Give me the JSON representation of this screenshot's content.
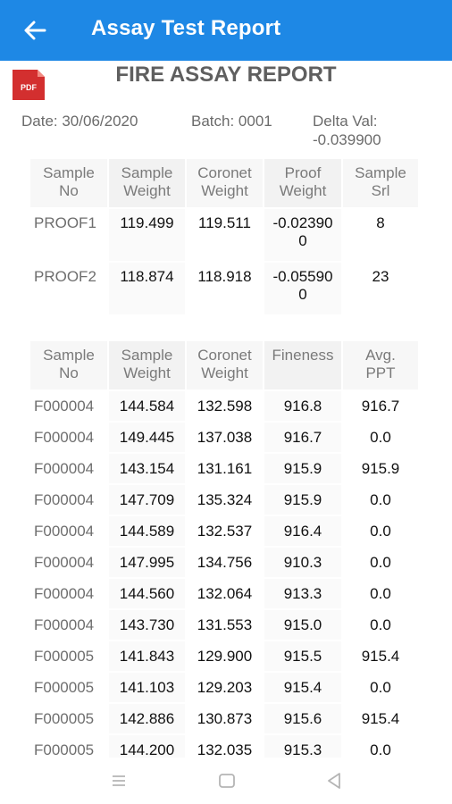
{
  "appbar": {
    "title": "Assay Test Report",
    "back_icon": "arrow-left-icon"
  },
  "report": {
    "pdf_label": "PDF",
    "title": "FIRE ASSAY REPORT",
    "date": "Date: 30/06/2020",
    "batch": "Batch: 0001",
    "delta_label": "Delta Val:",
    "delta_value": "-0.039900"
  },
  "proof_table": {
    "headers": [
      [
        "Sample",
        "No"
      ],
      [
        "Sample",
        "Weight"
      ],
      [
        "Coronet",
        "Weight"
      ],
      [
        "Proof",
        "Weight"
      ],
      [
        "Sample",
        "Srl"
      ]
    ],
    "rows": [
      [
        "PROOF1",
        "119.499",
        "119.511",
        "-0.02390",
        "0",
        "8"
      ],
      [
        "PROOF2",
        "118.874",
        "118.918",
        "-0.05590",
        "0",
        "23"
      ]
    ]
  },
  "sample_table": {
    "headers": [
      [
        "Sample",
        "No"
      ],
      [
        "Sample",
        "Weight"
      ],
      [
        "Coronet",
        "Weight"
      ],
      [
        "Fineness",
        ""
      ],
      [
        "Avg.",
        "PPT"
      ]
    ],
    "rows": [
      [
        "F000004",
        "144.584",
        "132.598",
        "916.8",
        "916.7"
      ],
      [
        "F000004",
        "149.445",
        "137.038",
        "916.7",
        "0.0"
      ],
      [
        "F000004",
        "143.154",
        "131.161",
        "915.9",
        "915.9"
      ],
      [
        "F000004",
        "147.709",
        "135.324",
        "915.9",
        "0.0"
      ],
      [
        "F000004",
        "144.589",
        "132.537",
        "916.4",
        "0.0"
      ],
      [
        "F000004",
        "147.995",
        "134.756",
        "910.3",
        "0.0"
      ],
      [
        "F000004",
        "144.560",
        "132.064",
        "913.3",
        "0.0"
      ],
      [
        "F000004",
        "143.730",
        "131.553",
        "915.0",
        "0.0"
      ],
      [
        "F000005",
        "141.843",
        "129.900",
        "915.5",
        "915.4"
      ],
      [
        "F000005",
        "141.103",
        "129.203",
        "915.4",
        "0.0"
      ],
      [
        "F000005",
        "142.886",
        "130.873",
        "915.6",
        "915.4"
      ],
      [
        "F000005",
        "144.200",
        "132.035",
        "915.3",
        "0.0"
      ]
    ]
  },
  "navbar": {
    "items": [
      "menu-icon",
      "home-square-icon",
      "back-triangle-icon"
    ]
  },
  "colors": {
    "appbar": "#1e88e5",
    "pdf_red": "#d32f2f"
  }
}
